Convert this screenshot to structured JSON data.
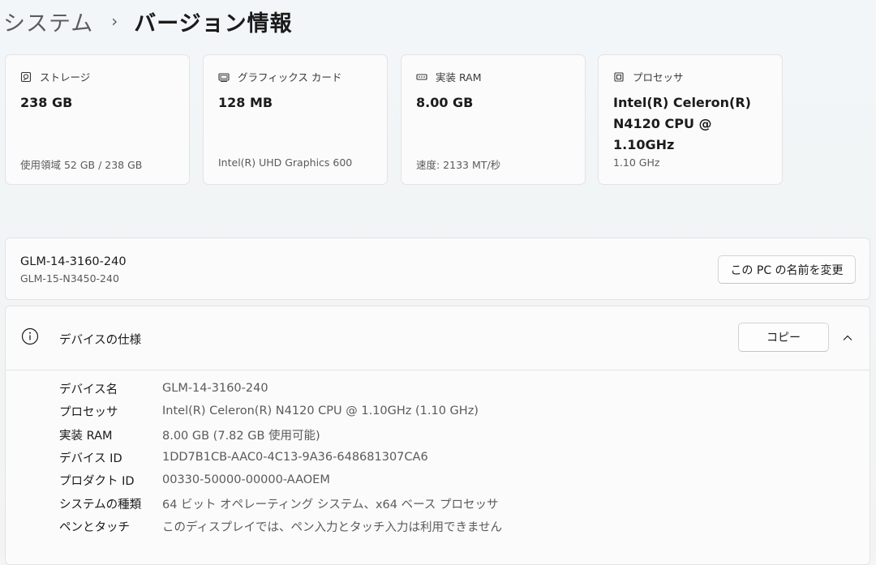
{
  "breadcrumb": {
    "parent": "システム",
    "separator": "›",
    "current": "バージョン情報"
  },
  "cards": [
    {
      "icon": "storage-icon",
      "title": "ストレージ",
      "value": "238 GB",
      "sub": "使用領域 52 GB / 238 GB"
    },
    {
      "icon": "graphics-card-icon",
      "title": "グラフィックス カード",
      "value": "128 MB",
      "sub": "Intel(R) UHD Graphics 600"
    },
    {
      "icon": "ram-icon",
      "title": "実装 RAM",
      "value": "8.00 GB",
      "sub": "速度: 2133 MT/秒"
    },
    {
      "icon": "processor-icon",
      "title": "プロセッサ",
      "value": "Intel(R) Celeron(R) N4120 CPU @ 1.10GHz",
      "sub": "1.10 GHz"
    }
  ],
  "device_name_panel": {
    "name": "GLM-14-3160-240",
    "model": "GLM-15-N3450-240",
    "rename_label": "この PC の名前を変更"
  },
  "spec": {
    "title": "デバイスの仕様",
    "copy_label": "コピー",
    "rows": [
      {
        "label": "デバイス名",
        "value": "GLM-14-3160-240"
      },
      {
        "label": "プロセッサ",
        "value": "Intel(R) Celeron(R) N4120 CPU @ 1.10GHz (1.10 GHz)"
      },
      {
        "label": "実装 RAM",
        "value": "8.00 GB (7.82 GB 使用可能)"
      },
      {
        "label": "デバイス ID",
        "value": "1DD7B1CB-AAC0-4C13-9A36-648681307CA6"
      },
      {
        "label": "プロダクト ID",
        "value": "00330-50000-00000-AAOEM"
      },
      {
        "label": "システムの種類",
        "value": "64 ビット オペレーティング システム、x64 ベース プロセッサ"
      },
      {
        "label": "ペンとタッチ",
        "value": "このディスプレイでは、ペン入力とタッチ入力は利用できません"
      }
    ]
  }
}
